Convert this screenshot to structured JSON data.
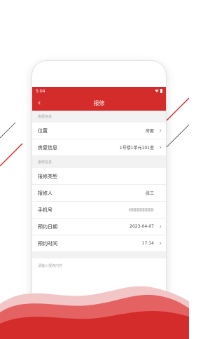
{
  "statusbar": {
    "time": "5:04"
  },
  "navbar": {
    "back_glyph": "‹",
    "title": "报修"
  },
  "sections": {
    "house_header": "房屋信息",
    "repair_header": "报修信息"
  },
  "house_rows": [
    {
      "label": "位置",
      "value": "房屋"
    },
    {
      "label": "房屋信息",
      "value": "1号楼1单元101室"
    }
  ],
  "repair_rows": {
    "type": {
      "label": "报修类型",
      "value": ""
    },
    "person": {
      "label": "报修人",
      "value": "张三"
    },
    "phone": {
      "label": "手机号"
    },
    "date": {
      "label": "预约日期",
      "value": "2023-04-07"
    },
    "time": {
      "label": "预约时间",
      "value": "17:14"
    }
  },
  "content_input": {
    "placeholder": "请输入报修内容"
  },
  "colors": {
    "brand_red": "#d42b2b",
    "section_bg": "#f2f2f2"
  },
  "icons": [
    "back-arrow-icon",
    "wifi-icon",
    "battery-icon",
    "chevron-right-icon"
  ]
}
